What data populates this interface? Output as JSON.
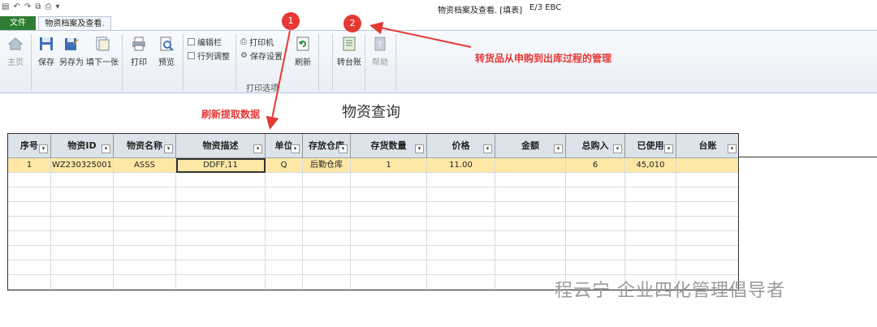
{
  "window": {
    "title": "物资档案及查看. [填表]",
    "subtitle": "E/3 EBC"
  },
  "tabs": {
    "file": "文件",
    "active": "物资档案及查看."
  },
  "ribbon": {
    "home": "主页",
    "save": "保存",
    "save_as": "另存为",
    "fill_next": "填下一张",
    "print": "打印",
    "preview": "预览",
    "edit_bar": "编辑栏",
    "col_adjust": "行列调整",
    "printer": "打印机",
    "save_settings": "保存设置",
    "refresh": "刷新",
    "print_options": "打印选项",
    "transfer_ledger": "转台账",
    "help": "帮助"
  },
  "page_title": "物资查询",
  "annotations": {
    "circle1": "1",
    "circle2": "2",
    "text1": "刷新提取数据",
    "text2": "转货品从申购到出库过程的管理",
    "color": "#e53935"
  },
  "table": {
    "columns": [
      "序号",
      "物资ID",
      "物资名称",
      "物资描述",
      "单位",
      "存放仓库",
      "存货数量",
      "价格",
      "金额",
      "总购入",
      "已使用",
      "台账"
    ],
    "rows": [
      [
        "1",
        "WZ230325001",
        "ASSS",
        "DDFF,11",
        "Q",
        "后勤仓库",
        "1",
        "11.00",
        "",
        "6",
        "45,010",
        ""
      ]
    ],
    "empty_rows": 8
  },
  "watermark": "程云宁 企业四化管理倡导者",
  "colors": {
    "file_tab": "#2e7d32",
    "selected_row": "#ffe7a6"
  }
}
